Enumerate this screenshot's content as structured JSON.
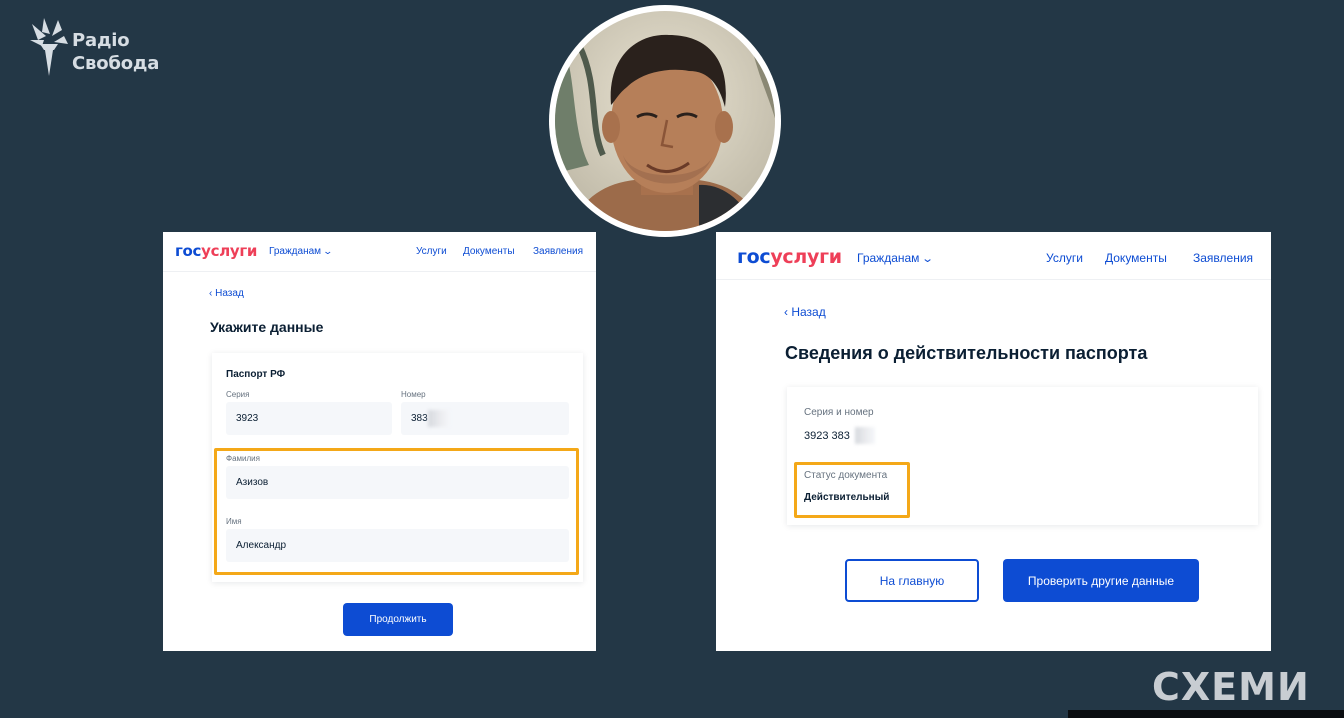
{
  "brand": {
    "radio_line1": "Радіо",
    "radio_line2": "Свобода",
    "show_watermark": "СХЕМИ"
  },
  "colors": {
    "background": "#233746",
    "gosuslugi_blue": "#0d4cd3",
    "gosuslugi_red": "#ee3f58",
    "highlight": "#f4a818"
  },
  "left_screen": {
    "logo_part1": "гос",
    "logo_part2": "услуги",
    "menu_label": "Гражданам",
    "nav": [
      "Услуги",
      "Документы",
      "Заявления"
    ],
    "back_label": "Назад",
    "title": "Укажите данные",
    "section_title": "Паспорт РФ",
    "series_label": "Серия",
    "series_value": "3923",
    "number_label": "Номер",
    "number_value": "383",
    "surname_label": "Фамилия",
    "surname_value": "Азизов",
    "name_label": "Имя",
    "name_value": "Александр",
    "continue_button": "Продолжить"
  },
  "right_screen": {
    "logo_part1": "гос",
    "logo_part2": "услуги",
    "menu_label": "Гражданам",
    "nav": [
      "Услуги",
      "Документы",
      "Заявления"
    ],
    "back_label": "Назад",
    "title": "Сведения о действительности паспорта",
    "series_number_label": "Серия и номер",
    "series_number_value": "3923 383",
    "status_label": "Статус документа",
    "status_value": "Действительный",
    "home_button": "На главную",
    "check_other_button": "Проверить другие данные"
  }
}
